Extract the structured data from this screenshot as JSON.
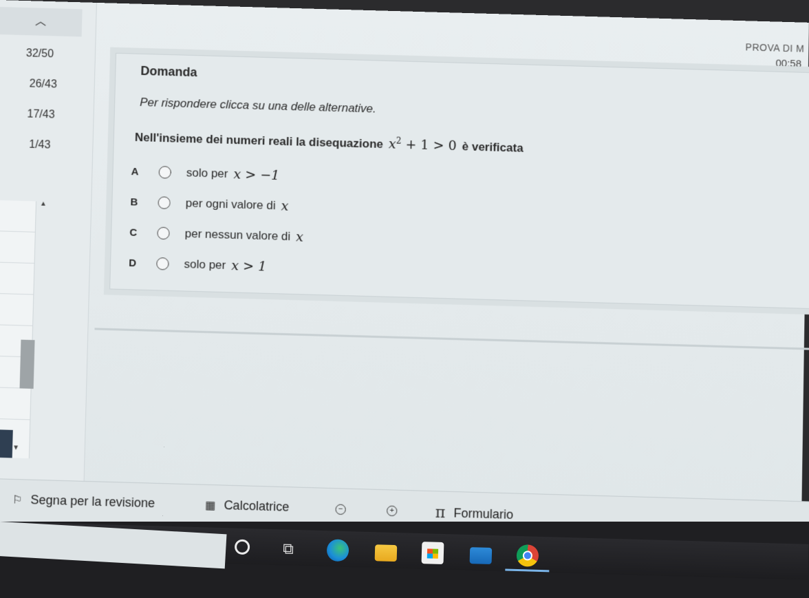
{
  "header": {
    "title": "PROVA DI M",
    "timer": "00:58"
  },
  "sidebar": {
    "collapse_icon": "chevron-up-icon",
    "items": [
      {
        "label": "32/50"
      },
      {
        "label": "26/43"
      },
      {
        "label": "17/43"
      },
      {
        "label": "1/43"
      }
    ]
  },
  "question": {
    "heading": "Domanda",
    "instructions": "Per rispondere clicca su una delle alternative.",
    "text_before": "Nell'insieme dei numeri reali la disequazione",
    "math": {
      "base": "x",
      "exp": "2",
      "rest": "+ 1 > 0"
    },
    "text_after": "è verificata",
    "options": [
      {
        "letter": "A",
        "label": "solo per",
        "math": "x > −1"
      },
      {
        "letter": "B",
        "label": "per ogni valore di",
        "math": "x"
      },
      {
        "letter": "C",
        "label": "per nessun valore di",
        "math": "x"
      },
      {
        "letter": "D",
        "label": "solo per",
        "math": "x > 1"
      }
    ]
  },
  "toolbar": {
    "flag_label": "Segna per la revisione",
    "calculator_label": "Calcolatrice",
    "zoom_out_symbol": "−",
    "zoom_in_symbol": "+",
    "pi_symbol": "π",
    "formulary_label": "Formulario"
  },
  "taskbar": {
    "taskview_symbol": "⧉"
  }
}
